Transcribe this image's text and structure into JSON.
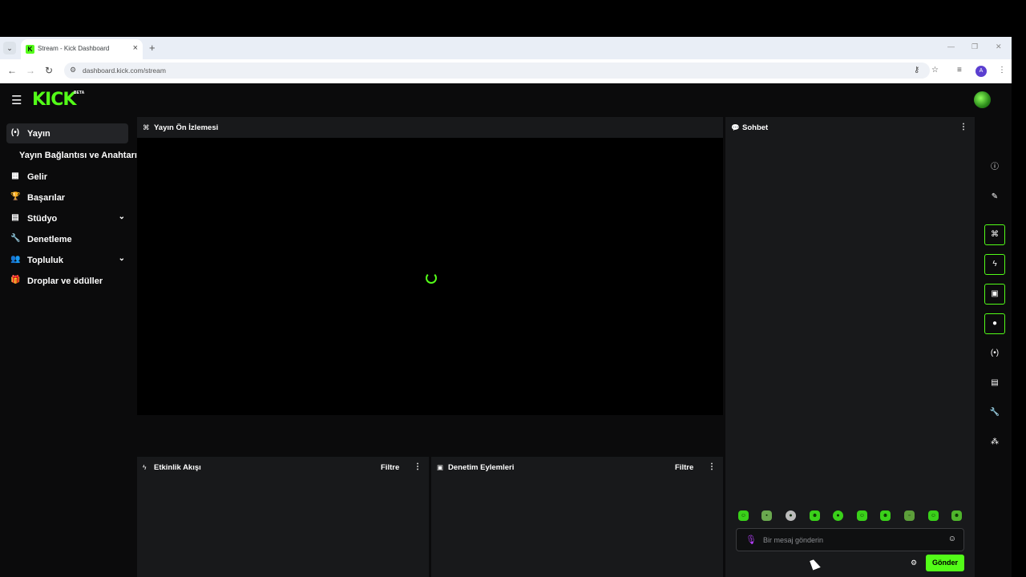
{
  "browser": {
    "tab_title": "Stream - Kick Dashboard",
    "url": "dashboard.kick.com/stream",
    "profile_initial": "A"
  },
  "app": {
    "logo": "KICK",
    "logo_badge": "BETA"
  },
  "sidebar": {
    "items": [
      {
        "label": "Yayın",
        "icon": "broadcast-icon",
        "active": true
      },
      {
        "label": "Gelir",
        "icon": "chart-icon"
      },
      {
        "label": "Başarılar",
        "icon": "trophy-icon"
      },
      {
        "label": "Stüdyo",
        "icon": "studio-icon",
        "expandable": true
      },
      {
        "label": "Denetleme",
        "icon": "wrench-icon"
      },
      {
        "label": "Topluluk",
        "icon": "community-icon",
        "expandable": true
      },
      {
        "label": "Droplar ve ödüller",
        "icon": "gift-icon"
      }
    ],
    "sub_item": "Yayın Bağlantısı ve Anahtarı"
  },
  "panels": {
    "preview_title": "Yayın Ön İzlemesi",
    "activity_title": "Etkinlik Akışı",
    "moderation_title": "Denetim Eylemleri",
    "filter_label": "Filtre",
    "chat_title": "Sohbet"
  },
  "chat": {
    "placeholder": "Bir mesaj gönderin",
    "send_label": "Gönder"
  },
  "colors": {
    "accent": "#53fc18",
    "panel": "#18191b",
    "background": "#0b0b0c"
  }
}
